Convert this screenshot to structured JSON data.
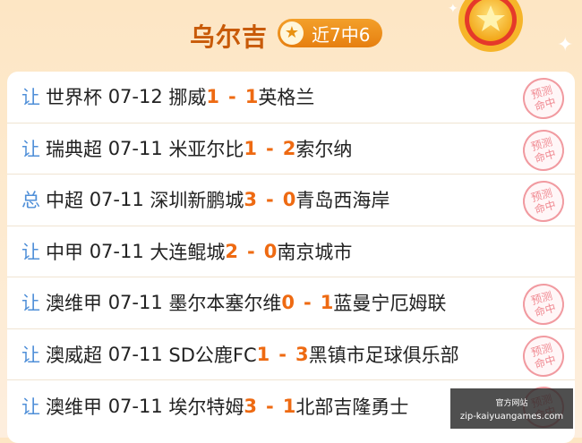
{
  "header": {
    "name": "乌尔吉",
    "streak_label": "近7中6"
  },
  "stamp_text": [
    "预测",
    "命中"
  ],
  "matches": [
    {
      "tag": "让",
      "league": "世界杯",
      "date": "07-12",
      "home": "挪威",
      "home_score": "1",
      "away_score": "1",
      "away": "英格兰",
      "hit": true
    },
    {
      "tag": "让",
      "league": "瑞典超",
      "date": "07-11",
      "home": "米亚尔比",
      "home_score": "1",
      "away_score": "2",
      "away": "索尔纳",
      "hit": true
    },
    {
      "tag": "总",
      "league": "中超",
      "date": "07-11",
      "home": "深圳新鹏城",
      "home_score": "3",
      "away_score": "0",
      "away": "青岛西海岸",
      "hit": true
    },
    {
      "tag": "让",
      "league": "中甲",
      "date": "07-11",
      "home": "大连鲲城",
      "home_score": "2",
      "away_score": "0",
      "away": "南京城市",
      "hit": false
    },
    {
      "tag": "让",
      "league": "澳维甲",
      "date": "07-11",
      "home": "墨尔本塞尔维",
      "home_score": "0",
      "away_score": "1",
      "away": "蓝曼宁厄姆联",
      "hit": true
    },
    {
      "tag": "让",
      "league": "澳威超",
      "date": "07-11",
      "home": "SD公鹿FC",
      "home_score": "1",
      "away_score": "3",
      "away": "黑镇市足球俱乐部",
      "hit": true
    },
    {
      "tag": "让",
      "league": "澳维甲",
      "date": "07-11",
      "home": "埃尔特姆",
      "home_score": "3",
      "away_score": "1",
      "away": "北部吉隆勇士",
      "hit": true
    }
  ],
  "watermark": {
    "top": "官方网站",
    "url": "zip-kaiyuangames.com"
  },
  "colors": {
    "accent": "#ee6a12",
    "tag": "#4f8fd8",
    "title": "#c85a08",
    "stamp": "#f08a92"
  }
}
